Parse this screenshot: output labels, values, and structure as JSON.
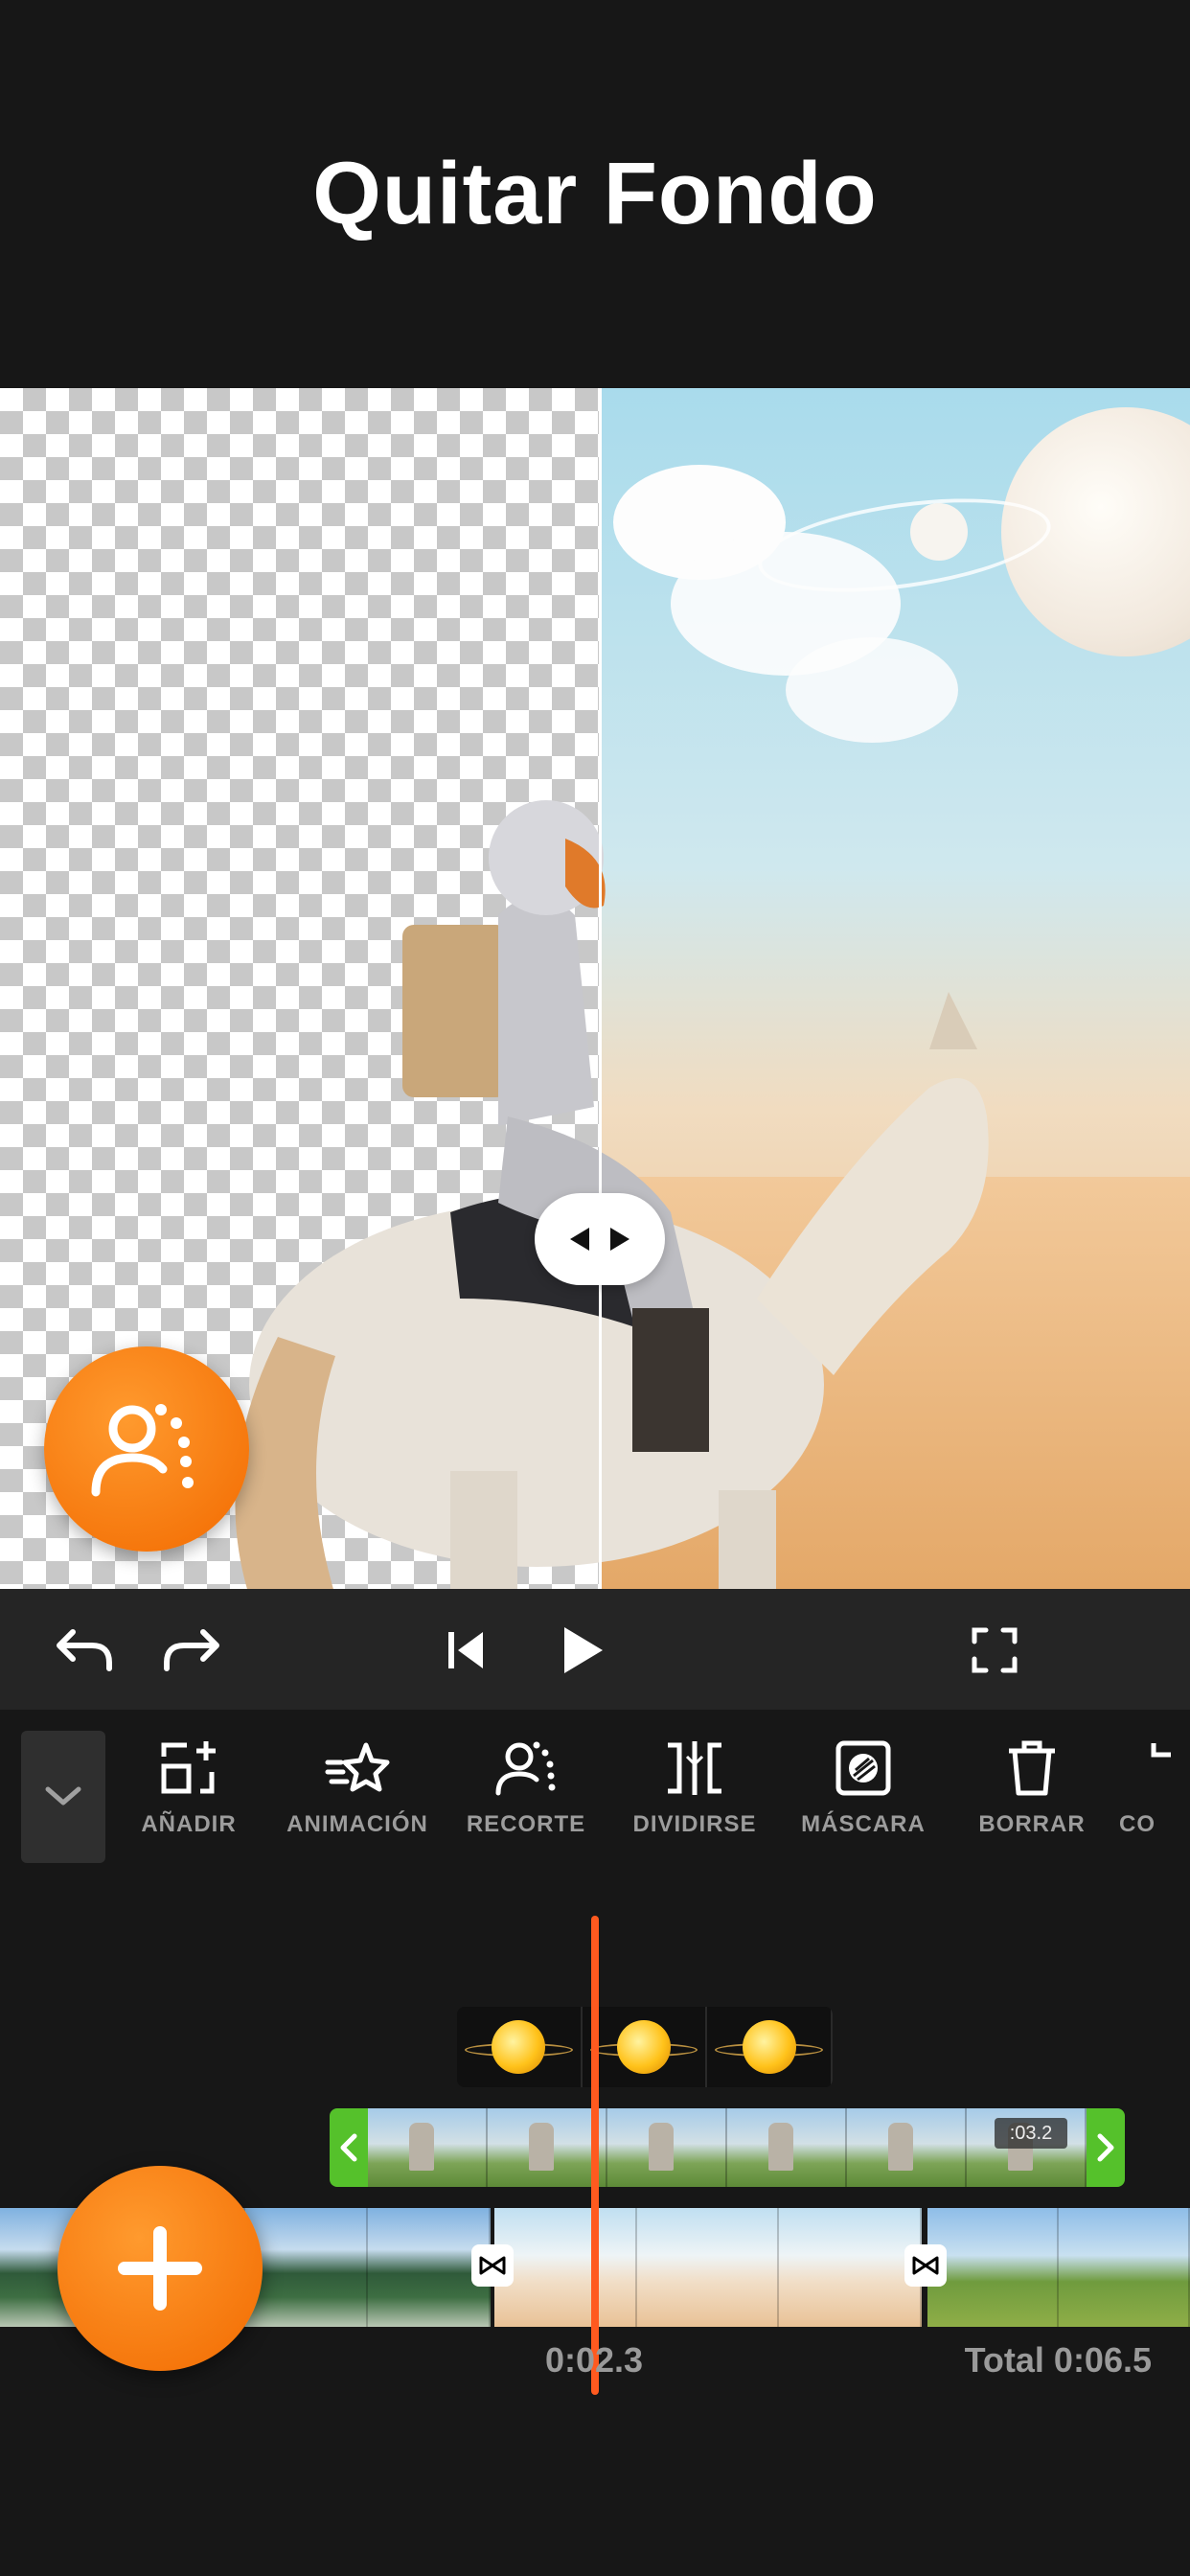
{
  "header": {
    "title": "Quitar Fondo"
  },
  "colors": {
    "accent": "#ff7a0f",
    "playhead": "#ff5a1f",
    "selection": "#55c12b",
    "background": "#171717"
  },
  "controls": {
    "undo_icon": "undo-arrow-icon",
    "redo_icon": "redo-arrow-icon",
    "skip_start_icon": "skip-to-start-icon",
    "play_icon": "play-icon",
    "fullscreen_icon": "fullscreen-icon"
  },
  "toolbar": {
    "items": [
      {
        "label": "AÑADIR",
        "icon": "add-layer-icon"
      },
      {
        "label": "ANIMACIÓN",
        "icon": "animation-star-icon"
      },
      {
        "label": "RECORTE",
        "icon": "cutout-person-icon"
      },
      {
        "label": "DIVIDIRSE",
        "icon": "split-icon"
      },
      {
        "label": "MÁSCARA",
        "icon": "mask-icon"
      },
      {
        "label": "BORRAR",
        "icon": "trash-icon"
      },
      {
        "label": "CO",
        "icon": "copy-icon"
      }
    ]
  },
  "timeline": {
    "selected_clip_duration": ":03.2",
    "current_time": "0:02.3",
    "total_time": "Total 0:06.5"
  }
}
